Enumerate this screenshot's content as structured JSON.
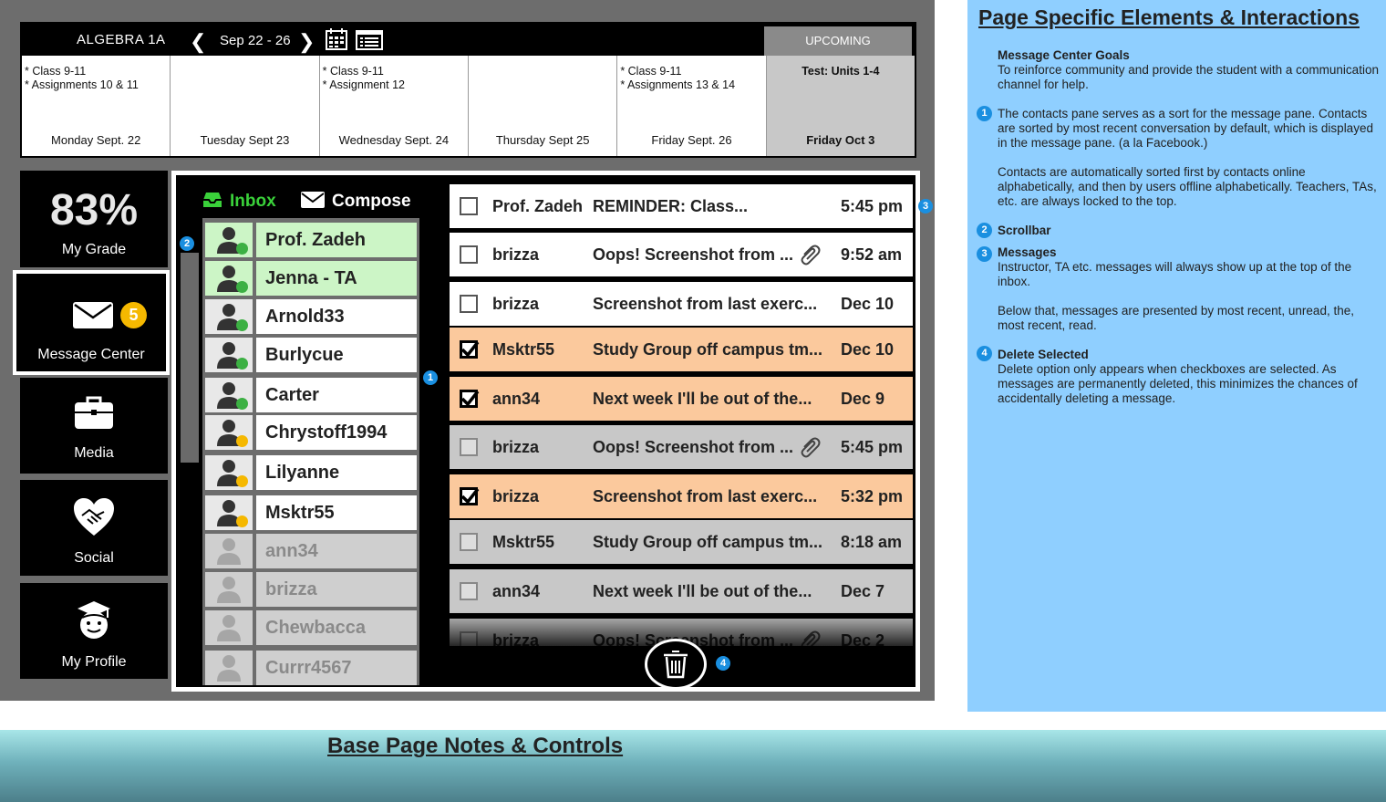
{
  "calendar": {
    "course_title": "ALGEBRA 1A",
    "date_range": "Sep 22 - 26",
    "upcoming_tab": "UPCOMING",
    "days": [
      {
        "notes": "* Class 9-11\n* Assignments 10 & 11",
        "label": "Monday Sept. 22"
      },
      {
        "notes": "",
        "label": "Tuesday Sept 23"
      },
      {
        "notes": "* Class 9-11\n* Assignment 12",
        "label": "Wednesday Sept. 24"
      },
      {
        "notes": "",
        "label": "Thursday Sept 25"
      },
      {
        "notes": "* Class 9-11\n* Assignments 13 & 14",
        "label": "Friday  Sept. 26"
      },
      {
        "notes": "Test: Units 1-4",
        "label": "Friday Oct 3"
      }
    ]
  },
  "nav": {
    "grade_value": "83%",
    "grade_label": "My Grade",
    "message_label": "Message Center",
    "message_badge": "5",
    "media_label": "Media",
    "social_label": "Social",
    "profile_label": "My Profile"
  },
  "message_center": {
    "inbox_tab": "Inbox",
    "compose_tab": "Compose",
    "contacts": [
      {
        "name": "Prof. Zadeh",
        "status": "online",
        "pinned": true
      },
      {
        "name": "Jenna - TA",
        "status": "online",
        "pinned": true
      },
      {
        "name": "Arnold33",
        "status": "online",
        "pinned": false
      },
      {
        "name": "Burlycue",
        "status": "online",
        "pinned": false
      },
      {
        "name": "Carter",
        "status": "online",
        "pinned": false
      },
      {
        "name": "Chrystoff1994",
        "status": "away",
        "pinned": false
      },
      {
        "name": "Lilyanne",
        "status": "away",
        "pinned": false
      },
      {
        "name": "Msktr55",
        "status": "away",
        "pinned": false
      },
      {
        "name": "ann34",
        "status": "offline",
        "pinned": false
      },
      {
        "name": "brizza",
        "status": "offline",
        "pinned": false
      },
      {
        "name": "Chewbacca",
        "status": "offline",
        "pinned": false
      },
      {
        "name": "Currr4567",
        "status": "offline",
        "pinned": false
      }
    ],
    "messages": [
      {
        "from": "Prof. Zadeh",
        "subject": "REMINDER: Class...",
        "time": "5:45 pm",
        "state": "unread",
        "checked": false,
        "attachment": false
      },
      {
        "from": "brizza",
        "subject": "Oops! Screenshot from ...",
        "time": "9:52 am",
        "state": "unread",
        "checked": false,
        "attachment": true
      },
      {
        "from": "brizza",
        "subject": "Screenshot from last exerc...",
        "time": "Dec 10",
        "state": "unread",
        "checked": false,
        "attachment": false
      },
      {
        "from": "Msktr55",
        "subject": "Study Group off campus tm...",
        "time": "Dec  10",
        "state": "selected",
        "checked": true,
        "attachment": false
      },
      {
        "from": "ann34",
        "subject": "Next week I'll be out of the...",
        "time": "Dec 9",
        "state": "selected",
        "checked": true,
        "attachment": false
      },
      {
        "from": "brizza",
        "subject": "Oops! Screenshot from ...",
        "time": "5:45 pm",
        "state": "read",
        "checked": false,
        "attachment": true
      },
      {
        "from": "brizza",
        "subject": "Screenshot from last exerc...",
        "time": "5:32 pm",
        "state": "selected",
        "checked": true,
        "attachment": false
      },
      {
        "from": "Msktr55",
        "subject": "Study Group off campus tm...",
        "time": "8:18 am",
        "state": "read",
        "checked": false,
        "attachment": false
      },
      {
        "from": "ann34",
        "subject": "Next week I'll be out of the...",
        "time": "Dec 7",
        "state": "read",
        "checked": false,
        "attachment": false
      },
      {
        "from": "brizza",
        "subject": "Oops! Screenshot from ...",
        "time": "Dec 2",
        "state": "read",
        "checked": false,
        "attachment": true
      }
    ],
    "callouts": [
      "1",
      "2",
      "3",
      "4"
    ]
  },
  "notes_panel": {
    "title": "Page Specific Elements & Interactions",
    "goals_heading": "Message Center Goals",
    "goals_text": "To reinforce community and provide the student with a communication channel for help.",
    "item1_num": "1",
    "item1_text_a": "The contacts pane serves as a sort for the message pane. Contacts are sorted by most recent conversation by default, which is displayed in the message pane. (a la Facebook.)",
    "item1_text_b": "Contacts are automatically sorted first by contacts online alphabetically, and then by users offline alphabetically. Teachers, TAs, etc. are always locked to the top.",
    "item2_num": "2",
    "item2_heading": "Scrollbar",
    "item3_num": "3",
    "item3_heading": "Messages",
    "item3_text_a": "Instructor, TA etc. messages will always show up at the top of the inbox.",
    "item3_text_b": "Below that, messages are presented by most recent, unread, the, most recent, read.",
    "item4_num": "4",
    "item4_heading": "Delete Selected",
    "item4_text": "Delete option only appears when checkboxes are selected. As messages are permanently deleted, this minimizes the chances of accidentally deleting a message."
  },
  "base": {
    "title": "Base Page Notes & Controls"
  },
  "colors": {
    "online": "#3cb043",
    "away": "#f5b800",
    "selected_row": "#fbc99d",
    "read_row": "#c8c8c8",
    "callout": "#1a8fe0",
    "notes_bg": "#8fcfff"
  }
}
